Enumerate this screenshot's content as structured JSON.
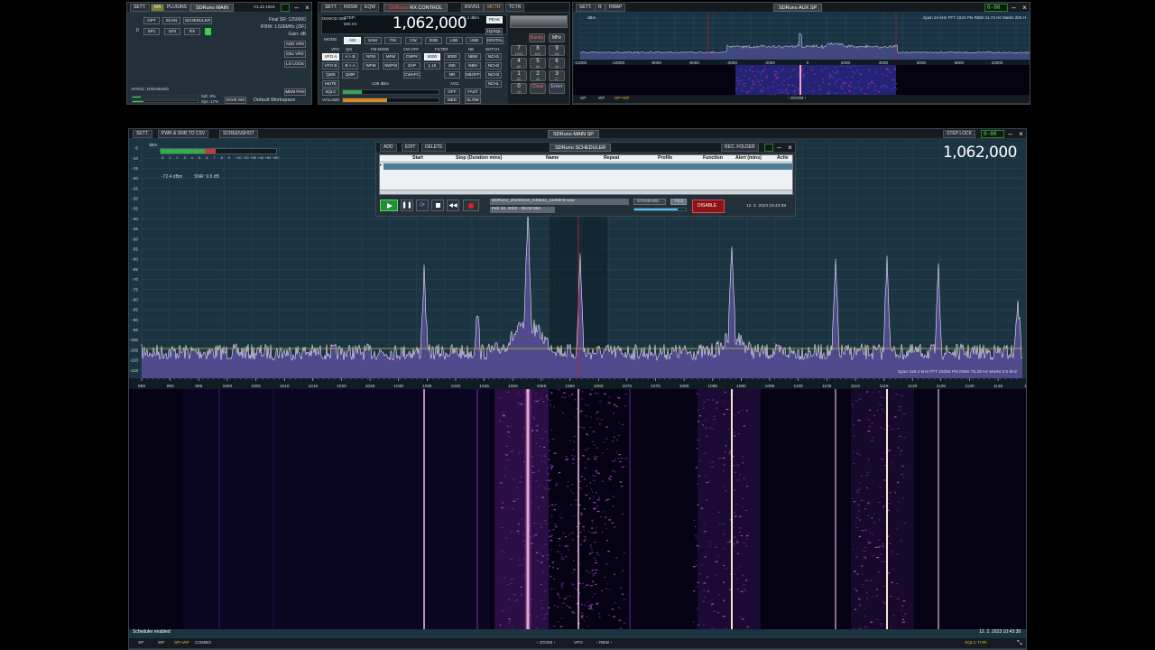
{
  "main_window": {
    "sett": "SETT.",
    "ma": "MA",
    "plugins": "PLUGINS",
    "title_brand": "SDRuno",
    "title_name": "MAIN",
    "version": "V1.42 1916",
    "opt": "OPT",
    "scan": "SCAN",
    "scheduler": "SCHEDULER",
    "sp1": "SP1",
    "sp2": "SP2",
    "rx": "RX",
    "rx_index": "0",
    "final_sr": "Final SR: 1250000",
    "if_bw": "IFBW: 1.536MHz (ZIF)",
    "gain": "Gain: dB",
    "add_vrx": "ADD VRX",
    "del_vrx": "DEL VRX",
    "lo_lock": "LO LOCK",
    "mem_pan": "MEM PAN",
    "ifagc": "IFAGC: DISABLED",
    "sdr_level": "Sdr: 8%",
    "sys_level": "Sys: 17%",
    "save_ws": "SAVE WS",
    "workspace": "Default Workspace"
  },
  "rx_control": {
    "sett": "SETT.",
    "rdsw": "RDSW",
    "eqw": "EQW",
    "title_brand": "SDRuno",
    "title_name": "RX CONTROL",
    "rsvn1": "RSVN1",
    "mctr": "MCTR",
    "tctr": "TCTR",
    "demod_label": "DEMOD 50u",
    "step_label": "STEP:",
    "step_value": "500 Hz",
    "frequency": "1,062,000",
    "level": "-72.4 dBm",
    "peak": "PEAK",
    "mode_label": "MODE",
    "modes": [
      "AM",
      "SAM",
      "FM",
      "CW",
      "DSB",
      "LSB",
      "USB",
      "DIGITAL"
    ],
    "vfo_label": "VFO",
    "qm_label": "QM",
    "fm_mode_label": "FM MODE",
    "cw_off_label": "CW OFF",
    "filter_label": "FILTER",
    "nb_label": "NB",
    "notch_label": "NOTCH",
    "vfo_a": "VFO A",
    "a_b": "A > B",
    "nfm": "NFM",
    "mfm": "MFM",
    "cwpk": "CWPK",
    "f6000": "6000",
    "nbw": "NBW",
    "nch1": "NCH1",
    "vfo_b": "VFO B",
    "b_a": "B > A",
    "wfm": "WFM",
    "swfm": "SWFM",
    "zap": "ZAP",
    "f1k": "1.1K",
    "f20k": "20K",
    "nbn": "NBN",
    "nch2": "NCH2",
    "qms": "QMS",
    "qmr": "QMR",
    "cwafc": "CWAFC",
    "nr": "NR",
    "nboff": "NBOFF",
    "nch3": "NCH3",
    "mute": "MUTE",
    "sqlc": "SQLC",
    "volume": "VOLUME",
    "sq_level": "-109 dBm",
    "agc_label": "AGC",
    "off": "OFF",
    "fast": "FAST",
    "nchl": "NCHL",
    "med": "MED",
    "slow": "SLOW",
    "f8000": "8000",
    "lsq": "1Q/SQL",
    "bands": "Bands",
    "mhz": "MHz",
    "keypad": [
      "7",
      "8",
      "9",
      "4",
      "5",
      "6",
      "1",
      "2",
      "3",
      "0",
      "Clear",
      "Enter"
    ],
    "band_labels": [
      "2200",
      "630",
      "160",
      "80",
      "60",
      "40",
      "30",
      "20",
      "17",
      "15",
      "12",
      "10"
    ]
  },
  "aux_sp": {
    "sett": "SETT.",
    "r": "R",
    "rmap": "RMAP",
    "title_brand": "SDRuno",
    "title_name": "AUX SP",
    "info": "Span 24 kHz  FFT 1024 Pts  RBW 11.72 Hz  Marks 200 H",
    "dbm_label": "dBm",
    "x_ticks": [
      "-12000",
      "-10000",
      "-8000",
      "-6000",
      "-4000",
      "-2000",
      "0",
      "2000",
      "4000",
      "6000",
      "8000",
      "10000",
      "12"
    ],
    "sp": "SP",
    "wf": "WF",
    "spwf": "SP+WF",
    "zoom": "ZOOM"
  },
  "main_sp": {
    "sett": "SETT.",
    "pwr_snr": "PWR & SNR TO CSV",
    "screenshot": "SCREENSHOT",
    "title_brand": "SDRuno",
    "title_name": "MAIN SP",
    "step_lock": "STEP LOCK",
    "frequency": "1,062,000",
    "dbm_label": "dBm",
    "smeter_ticks": [
      "S",
      "1",
      "2",
      "3",
      "4",
      "5",
      "6",
      "7",
      "8",
      "9",
      "+10",
      "+20",
      "+30",
      "+40",
      "+50",
      "+60"
    ],
    "level": "-72.4 dBm",
    "snr": "SNR: 9.9 dB",
    "y_ticks": [
      "-5",
      "-10",
      "-15",
      "-20",
      "-25",
      "-30",
      "-35",
      "-40",
      "-45",
      "-50",
      "-55",
      "-60",
      "-65",
      "-70",
      "-75",
      "-80",
      "-85",
      "-90",
      "-95",
      "-100",
      "-105",
      "-110",
      "-115",
      "-120"
    ],
    "x_ticks": [
      "985",
      "990",
      "995",
      "1000",
      "1005",
      "1010",
      "1015",
      "1020",
      "1025",
      "1030",
      "1035",
      "1040",
      "1045",
      "1050",
      "1055",
      "1060",
      "1065",
      "1070",
      "1075",
      "1080",
      "1085",
      "1090",
      "1095",
      "1100",
      "1105",
      "1110",
      "1115",
      "1120",
      "1125",
      "1130",
      "1135",
      "11"
    ],
    "info": "Span 156.3 kHz   FFT 16384 Pts   RBW 76.29 Hz   Marks 0.5 kHz",
    "status_left": "Scheduler enabled",
    "status_right": "12. 2. 2023 10:43:38",
    "sp": "SP",
    "wf": "WF",
    "spwf": "SP+WF",
    "combo": "COMBO",
    "zoom": "ZOOM",
    "vfo": "VFO",
    "rbw": "RBW",
    "sqlc_thr": "SQLC THR."
  },
  "scheduler": {
    "add": "ADD",
    "edit": "EDIT",
    "delete": "DELETE",
    "title_brand": "SDRuno",
    "title_name": "SCHEDULER",
    "rec_folder": "REC. FOLDER",
    "columns": [
      "Start",
      "Stop (Duration mins)",
      "Name",
      "Repeat",
      "Profile",
      "Function",
      "Alert (mins)",
      "Activ"
    ],
    "filename": "SDRuno_20230210_045642_1125kHz.wav",
    "rec_date": "Feb 10, 2023 - 05:03:382",
    "standard": "STANDARD",
    "file": "FILE",
    "disable": "DISABLE",
    "datetime": "12. 2. 2023 19:43:38"
  },
  "colors": {
    "accent_red": "#d8232a",
    "led_green": "#36d44a",
    "panel": "#1d2a33",
    "spectrum_fill": "#5a4f9a"
  }
}
